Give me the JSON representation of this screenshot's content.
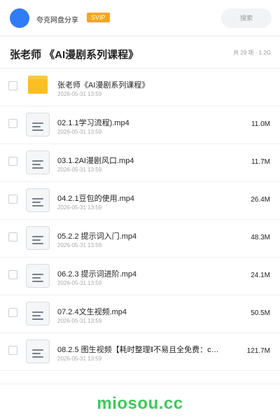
{
  "header": {
    "app_name": "夸克网盘分享",
    "badge": "SVIP",
    "search_placeholder": "搜索"
  },
  "folder": {
    "title": "张老师 《AI漫剧系列课程》",
    "summary": "共 29 项 · 1.2G"
  },
  "files": [
    {
      "type": "folder",
      "name": "张老师《AI漫剧系列课程》",
      "date": "2026-05-31 13:59",
      "size": ""
    },
    {
      "type": "file",
      "name": "02.1.1学习流程).mp4",
      "date": "2026-05-31 13:59",
      "size": "11.0M"
    },
    {
      "type": "file",
      "name": "03.1.2AI漫剧风口.mp4",
      "date": "2026-05-31 13:59",
      "size": "11.7M"
    },
    {
      "type": "file",
      "name": "04.2.1豆包的使用.mp4",
      "date": "2026-05-31 13:59",
      "size": "26.4M"
    },
    {
      "type": "file",
      "name": "05.2.2 提示词入门.mp4",
      "date": "2026-05-31 13:59",
      "size": "48.3M"
    },
    {
      "type": "file",
      "name": "06.2.3 提示词进阶.mp4",
      "date": "2026-05-31 13:59",
      "size": "24.1M"
    },
    {
      "type": "file",
      "name": "07.2.4文生视频.mp4",
      "date": "2026-05-31 13:59",
      "size": "50.5M"
    },
    {
      "type": "file",
      "name": "08.2.5 图生视频【耗时整理‖不易且全免费：c…",
      "date": "2026-05-31 13:59",
      "size": "121.7M"
    }
  ],
  "footer": {
    "watermark": "miosou.cc"
  },
  "colors": {
    "avatar": "#2f7cf6",
    "badge": "#f5a623",
    "folder": "#fbbf24",
    "watermark": "#3cc95a"
  }
}
